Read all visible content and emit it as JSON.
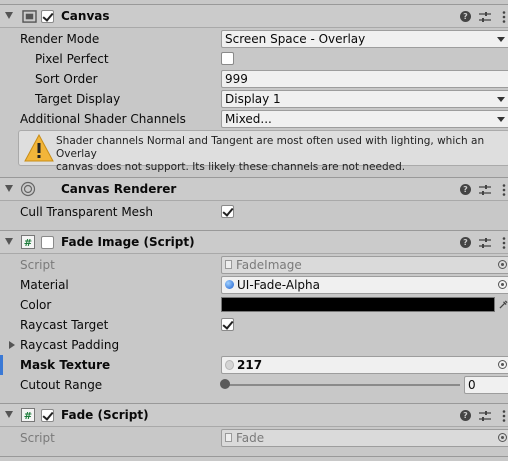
{
  "canvas": {
    "title": "Canvas",
    "enabled": true,
    "fields": {
      "render_mode": {
        "label": "Render Mode",
        "value": "Screen Space - Overlay"
      },
      "pixel_perfect": {
        "label": "Pixel Perfect",
        "checked": false
      },
      "sort_order": {
        "label": "Sort Order",
        "value": "999"
      },
      "target_display": {
        "label": "Target Display",
        "value": "Display 1"
      },
      "shader_channels": {
        "label": "Additional Shader Channels",
        "value": "Mixed..."
      }
    },
    "warning_line1": "Shader channels Normal and Tangent are most often used with lighting, which an Overlay",
    "warning_line2": "canvas does not support. Its likely these channels are not needed."
  },
  "canvas_renderer": {
    "title": "Canvas Renderer",
    "cull_label": "Cull Transparent Mesh",
    "cull_checked": true
  },
  "fade_image": {
    "title": "Fade Image (Script)",
    "enabled": false,
    "script_label": "Script",
    "script_value": "FadeImage",
    "material_label": "Material",
    "material_value": "UI-Fade-Alpha",
    "color_label": "Color",
    "color_value": "#000000",
    "raycast_target_label": "Raycast Target",
    "raycast_target_checked": true,
    "raycast_padding_label": "Raycast Padding",
    "mask_texture_label": "Mask Texture",
    "mask_texture_value": "217",
    "cutout_range_label": "Cutout Range",
    "cutout_range_value": "0",
    "cutout_range_fraction": 0
  },
  "fade": {
    "title": "Fade (Script)",
    "enabled": true,
    "script_label": "Script",
    "script_value": "Fade"
  },
  "colors": {
    "accent": "#3a79d6",
    "panel": "#c8c8c8",
    "header": "#cbcbcb"
  }
}
